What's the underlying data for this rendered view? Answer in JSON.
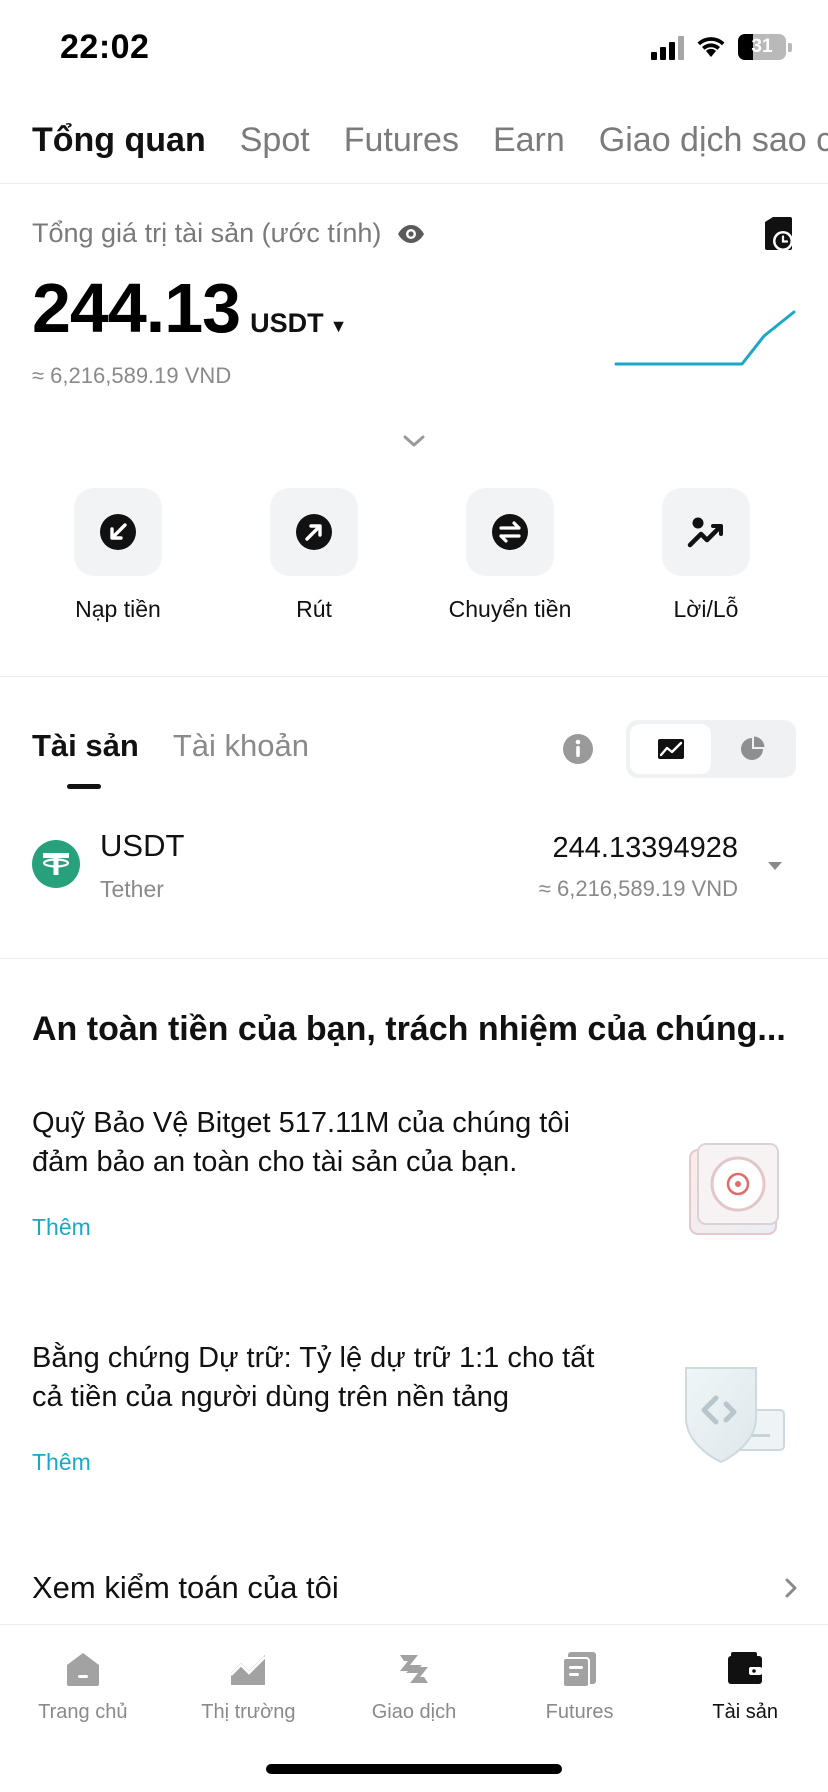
{
  "status_bar": {
    "time": "22:02",
    "battery": "31",
    "battery_level": 0.31
  },
  "top_tabs": [
    {
      "label": "Tổng quan",
      "active": true
    },
    {
      "label": "Spot",
      "active": false
    },
    {
      "label": "Futures",
      "active": false
    },
    {
      "label": "Earn",
      "active": false
    },
    {
      "label": "Giao dịch sao c",
      "active": false
    }
  ],
  "overview": {
    "label": "Tổng giá trị tài sản (ước tính)",
    "total_value": "244.13",
    "unit": "USDT",
    "vnd_approx": "≈ 6,216,589.19 VND",
    "accent_color": "#1aa8c4"
  },
  "actions": [
    {
      "label": "Nạp tiền",
      "icon": "deposit-icon"
    },
    {
      "label": "Rút",
      "icon": "withdraw-icon"
    },
    {
      "label": "Chuyển tiền",
      "icon": "transfer-icon"
    },
    {
      "label": "Lời/Lỗ",
      "icon": "pnl-icon"
    }
  ],
  "asset_tabs": [
    {
      "label": "Tài sản",
      "active": true
    },
    {
      "label": "Tài khoản",
      "active": false
    }
  ],
  "holdings": [
    {
      "symbol": "USDT",
      "name": "Tether",
      "amount": "244.13394928",
      "vnd": "≈ 6,216,589.19 VND",
      "logo_color": "#26a17b"
    }
  ],
  "safety": {
    "title": "An toàn tiền của bạn, trách nhiệm của chúng...",
    "promos": [
      {
        "text": "Quỹ Bảo Vệ Bitget 517.11M của chúng tôi đảm bảo an toàn cho tài sản của bạn.",
        "link": "Thêm",
        "icon": "vault-icon"
      },
      {
        "text": "Bằng chứng Dự trữ: Tỷ lệ dự trữ 1:1 cho tất cả tiền của người dùng trên nền tảng",
        "link": "Thêm",
        "icon": "shield-proof-icon"
      }
    ],
    "audit_label": "Xem kiểm toán của tôi"
  },
  "bottom_nav": [
    {
      "label": "Trang chủ",
      "icon": "home-icon",
      "active": false
    },
    {
      "label": "Thị trường",
      "icon": "market-icon",
      "active": false
    },
    {
      "label": "Giao dịch",
      "icon": "trade-icon",
      "active": false
    },
    {
      "label": "Futures",
      "icon": "futures-icon",
      "active": false
    },
    {
      "label": "Tài sản",
      "icon": "wallet-icon",
      "active": true
    }
  ]
}
